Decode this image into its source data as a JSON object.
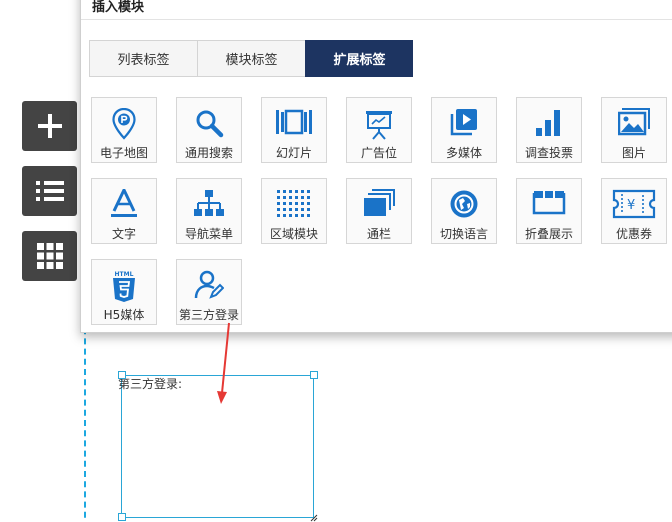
{
  "dialog": {
    "title": "插入模块",
    "tabs": [
      {
        "label": "列表标签",
        "active": false
      },
      {
        "label": "模块标签",
        "active": false
      },
      {
        "label": "扩展标签",
        "active": true
      }
    ],
    "modules": [
      {
        "label": "电子地图",
        "icon": "map-pin-icon"
      },
      {
        "label": "通用搜索",
        "icon": "search-icon"
      },
      {
        "label": "幻灯片",
        "icon": "slideshow-icon"
      },
      {
        "label": "广告位",
        "icon": "billboard-icon"
      },
      {
        "label": "多媒体",
        "icon": "media-play-icon"
      },
      {
        "label": "调查投票",
        "icon": "bar-chart-icon"
      },
      {
        "label": "图片",
        "icon": "image-icon"
      },
      {
        "label": "文字",
        "icon": "text-a-icon"
      },
      {
        "label": "导航菜单",
        "icon": "sitemap-icon"
      },
      {
        "label": "区域模块",
        "icon": "dotted-grid-icon"
      },
      {
        "label": "通栏",
        "icon": "stacked-layers-icon"
      },
      {
        "label": "切换语言",
        "icon": "globe-icon"
      },
      {
        "label": "折叠展示",
        "icon": "fold-icon"
      },
      {
        "label": "优惠券",
        "icon": "coupon-icon"
      },
      {
        "label": "H5媒体",
        "icon": "html5-icon"
      },
      {
        "label": "第三方登录",
        "icon": "user-edit-icon"
      }
    ]
  },
  "toolbar": {
    "buttons": [
      {
        "icon": "plus-icon"
      },
      {
        "icon": "list-icon"
      },
      {
        "icon": "grid-icon"
      }
    ]
  },
  "canvas": {
    "module_label": "第三方登录:"
  },
  "colors": {
    "accent": "#1d3461",
    "icon_blue": "#1a73c8",
    "toolbar_bg": "#444444",
    "selection": "#2aa6d6",
    "arrow": "#e53935"
  }
}
